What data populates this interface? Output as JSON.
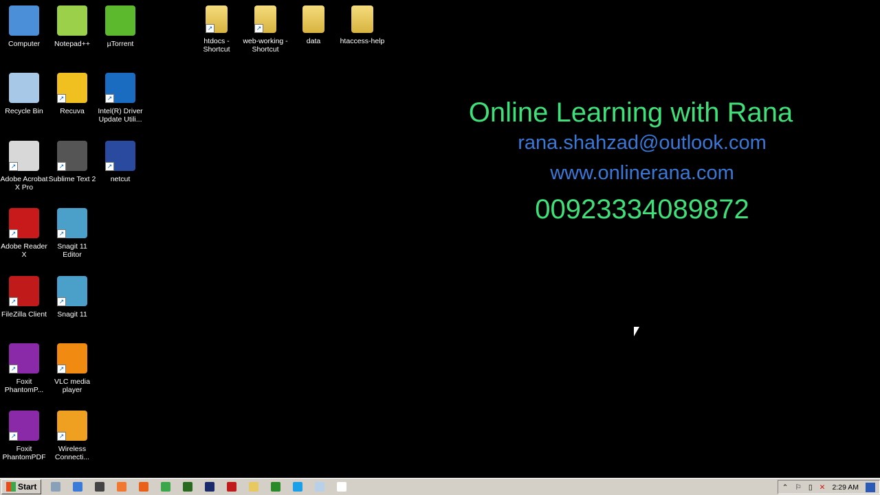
{
  "desktop_icons": [
    {
      "label": "Computer",
      "color": "#4a8fd8"
    },
    {
      "label": "Notepad++",
      "color": "#9bd04a"
    },
    {
      "label": "µTorrent",
      "color": "#5cb82c"
    },
    {
      "label": "Recycle Bin",
      "color": "#a8c8e8"
    },
    {
      "label": "Recuva",
      "color": "#f0c020"
    },
    {
      "label": "Intel(R) Driver Update Utili...",
      "color": "#1a6cc0"
    },
    {
      "label": "Adobe Acrobat X Pro",
      "color": "#d8d8d8"
    },
    {
      "label": "Sublime Text 2",
      "color": "#555555"
    },
    {
      "label": "netcut",
      "color": "#2a4aa0"
    },
    {
      "label": "Adobe Reader X",
      "color": "#c81a1a"
    },
    {
      "label": "Snagit 11 Editor",
      "color": "#4aa0c8"
    },
    {
      "label": "FileZilla Client",
      "color": "#c01a1a"
    },
    {
      "label": "Snagit 11",
      "color": "#4aa0c8"
    },
    {
      "label": "Foxit PhantomP...",
      "color": "#8a2aa8"
    },
    {
      "label": "VLC media player",
      "color": "#f08a10"
    },
    {
      "label": "Foxit PhantomPDF",
      "color": "#8a2aa8"
    },
    {
      "label": "Wireless Connecti...",
      "color": "#f0a020"
    }
  ],
  "folders": [
    {
      "label": "htdocs - Shortcut"
    },
    {
      "label": "web-working - Shortcut"
    },
    {
      "label": "data"
    },
    {
      "label": "htaccess-help"
    }
  ],
  "watermark": {
    "title": "Online Learning with Rana",
    "email": "rana.shahzad@outlook.com",
    "website": "www.onlinerana.com",
    "phone": "00923334089872"
  },
  "taskbar": {
    "start_label": "Start",
    "apps": [
      {
        "name": "network",
        "color": "#8aa0b8"
      },
      {
        "name": "powershell",
        "color": "#3a7ad8"
      },
      {
        "name": "window",
        "color": "#444444"
      },
      {
        "name": "xampp",
        "color": "#f07830"
      },
      {
        "name": "firefox",
        "color": "#e8601a"
      },
      {
        "name": "chrome",
        "color": "#3aa84a"
      },
      {
        "name": "dreamweaver",
        "color": "#2a6a20"
      },
      {
        "name": "photoshop",
        "color": "#1a2a6a"
      },
      {
        "name": "filezilla",
        "color": "#c01a1a"
      },
      {
        "name": "explorer",
        "color": "#e8c860"
      },
      {
        "name": "camtasia",
        "color": "#2a8a2a"
      },
      {
        "name": "skype",
        "color": "#1aa0e8"
      },
      {
        "name": "notepad",
        "color": "#b8d0e8"
      },
      {
        "name": "camtasia-recorder",
        "color": "#ffffff"
      }
    ],
    "clock": "2:29 AM"
  }
}
